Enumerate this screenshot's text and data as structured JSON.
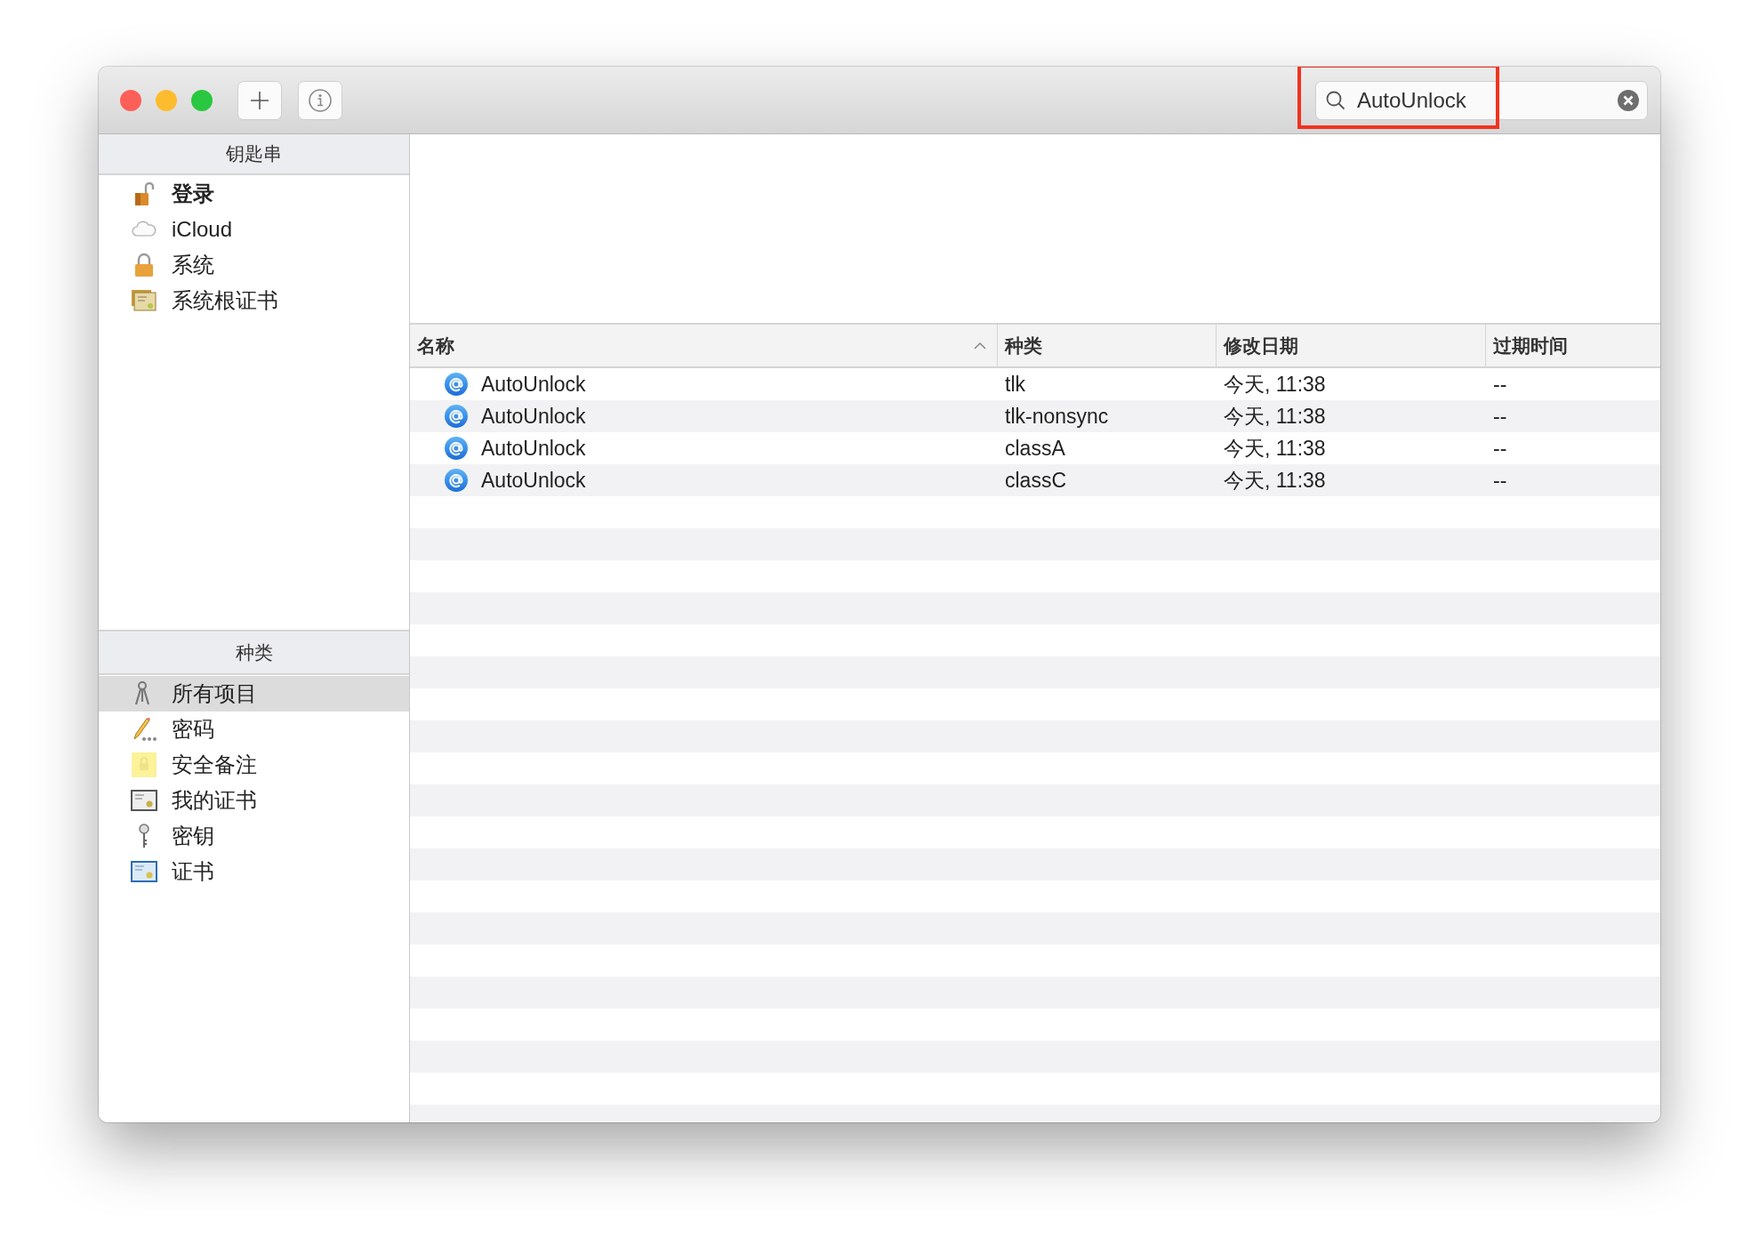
{
  "search": {
    "value": "AutoUnlock",
    "highlighted": true
  },
  "keychains": {
    "title": "钥匙串",
    "items": [
      {
        "label": "登录",
        "kind": "open-lock",
        "selected": true
      },
      {
        "label": "iCloud",
        "kind": "cloud",
        "selected": false
      },
      {
        "label": "系统",
        "kind": "lock",
        "selected": false
      },
      {
        "label": "系统根证书",
        "kind": "cert-stack",
        "selected": false
      }
    ]
  },
  "categories": {
    "title": "种类",
    "items": [
      {
        "label": "所有项目",
        "kind": "keys",
        "selected": true
      },
      {
        "label": "密码",
        "kind": "pencil",
        "selected": false
      },
      {
        "label": "安全备注",
        "kind": "note",
        "selected": false
      },
      {
        "label": "我的证书",
        "kind": "my-cert",
        "selected": false
      },
      {
        "label": "密钥",
        "kind": "key",
        "selected": false
      },
      {
        "label": "证书",
        "kind": "cert",
        "selected": false
      }
    ]
  },
  "table": {
    "columns": [
      {
        "label": "名称",
        "sorted": true
      },
      {
        "label": "种类",
        "sorted": false
      },
      {
        "label": "修改日期",
        "sorted": false
      },
      {
        "label": "过期时间",
        "sorted": false
      }
    ],
    "rows": [
      {
        "name": "AutoUnlock",
        "kind": "tlk",
        "modified": "今天, 11:38",
        "expires": "--"
      },
      {
        "name": "AutoUnlock",
        "kind": "tlk-nonsync",
        "modified": "今天, 11:38",
        "expires": "--"
      },
      {
        "name": "AutoUnlock",
        "kind": "classA",
        "modified": "今天, 11:38",
        "expires": "--"
      },
      {
        "name": "AutoUnlock",
        "kind": "classC",
        "modified": "今天, 11:38",
        "expires": "--"
      }
    ]
  }
}
